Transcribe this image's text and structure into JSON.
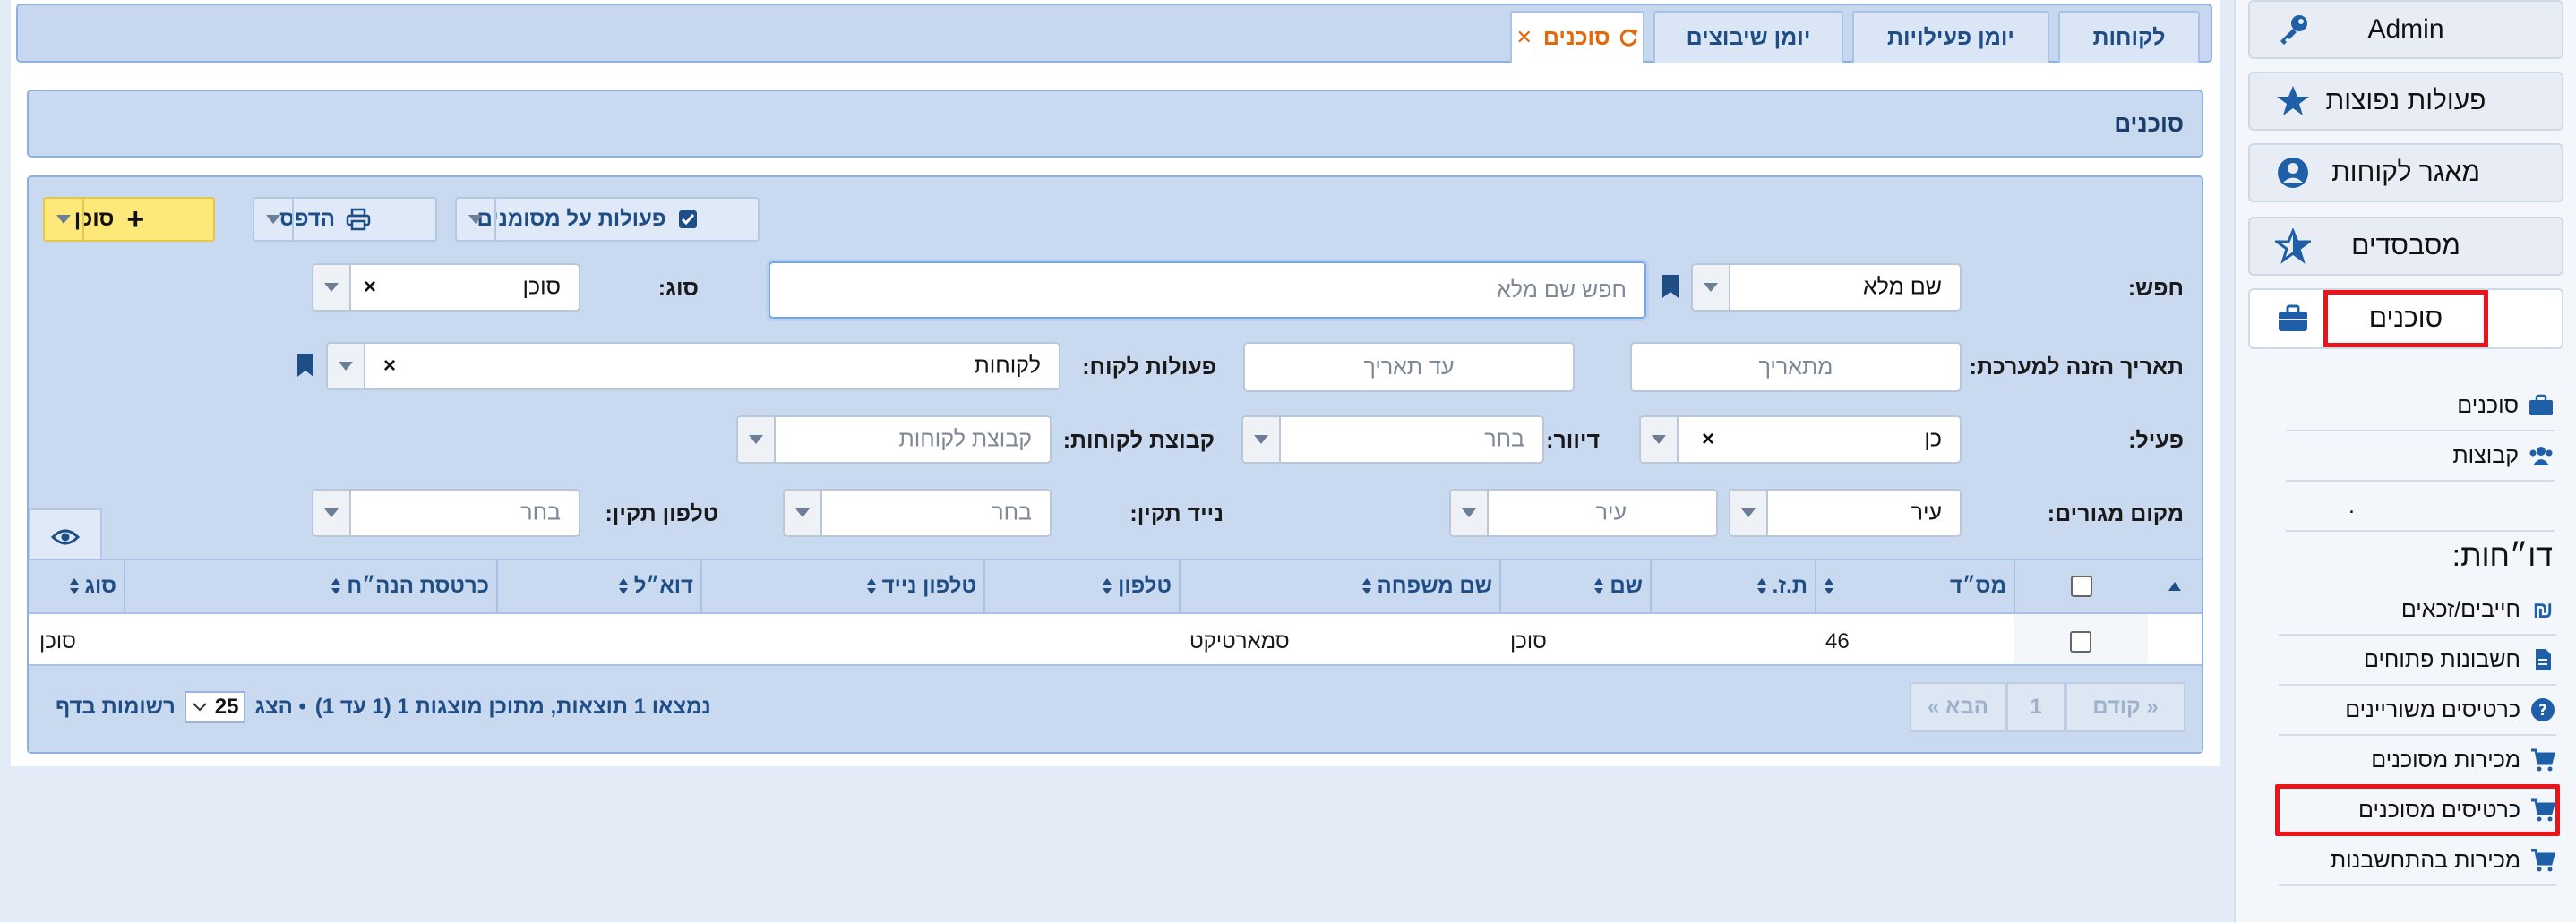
{
  "sidebar": {
    "buttons": [
      {
        "label": "Admin",
        "icon": "key-icon"
      },
      {
        "label": "פעולות נפוצות",
        "icon": "star-icon"
      },
      {
        "label": "מאגר לקוחות",
        "icon": "user-circle-icon"
      },
      {
        "label": "מסבסדים",
        "icon": "star-outline-icon"
      },
      {
        "label": "סוכנים",
        "icon": "briefcase-icon"
      }
    ],
    "sub_items": [
      {
        "label": "סוכנים"
      },
      {
        "label": "קבוצות"
      },
      {
        "label": "."
      }
    ],
    "reports_title": "דו״חות:",
    "report_items": [
      {
        "label": "חייבים/זכאים"
      },
      {
        "label": "חשבונות פתוחים"
      },
      {
        "label": "כרטיסים משוריינים"
      },
      {
        "label": "מכירות מסוכנים"
      },
      {
        "label": "כרטיסים מסוכנים"
      },
      {
        "label": "מכירות בהתחשבנות"
      }
    ]
  },
  "tabs": [
    {
      "label": "לקוחות"
    },
    {
      "label": "יומן פעילויות"
    },
    {
      "label": "יומן שיבוצים"
    },
    {
      "label": "סוכנים"
    }
  ],
  "page_title": "סוכנים",
  "toolbar": {
    "add_label": "סוכן",
    "print_label": "הדפס",
    "bulk_label": "פעולות על מסומנים"
  },
  "filters": {
    "search_label": "חפש:",
    "search_field_value": "שם מלא",
    "search_placeholder": "חפש שם מלא",
    "type_label": "סוג:",
    "type_value": "סוכן",
    "date_label": "תאריך הזנה למערכת:",
    "from_placeholder": "מתאריך",
    "to_placeholder": "עד תאריך",
    "customer_action_label": "פעולות לקוח:",
    "customer_action_value": "לקוחות",
    "active_label": "פעיל:",
    "active_value": "כן",
    "mailing_label": "דיוור:",
    "mailing_placeholder": "בחר",
    "group_label": "קבוצת לקוחות:",
    "group_placeholder": "קבוצת לקוחות",
    "residence_label": "מקום מגורים:",
    "city_value": "עיר",
    "city_placeholder": "עיר",
    "mobile_label": "נייד תקין:",
    "mobile_placeholder": "בחר",
    "phone_label": "טלפון תקין:",
    "phone_placeholder": "בחר"
  },
  "table": {
    "columns": [
      "מס״ד",
      "ת.ז.",
      "שם",
      "שם משפחה",
      "טלפון",
      "טלפון נייד",
      "דוא״ל",
      "כרטסת הנה״ח",
      "סוג"
    ],
    "rows": [
      {
        "id": "46",
        "tz": "",
        "first": "סוכן",
        "last": "סמארטיקט",
        "phone": "",
        "mobile": "",
        "email": "",
        "ledger": "",
        "type": "סוכן"
      }
    ]
  },
  "pagination": {
    "prev": "« קודם",
    "page": "1",
    "next": "הבא »",
    "summary": "נמצאו 1 תוצאות, מתוכן מוצגות 1 (1 עד 1)",
    "show_label": "• הצג",
    "per_page": "25",
    "per_page_suffix": "רשומות בדף"
  },
  "colors": {
    "accent": "#1f4e86",
    "active_tab": "#e4670a",
    "highlight": "#e8151b",
    "add_button": "#ffe87a"
  }
}
